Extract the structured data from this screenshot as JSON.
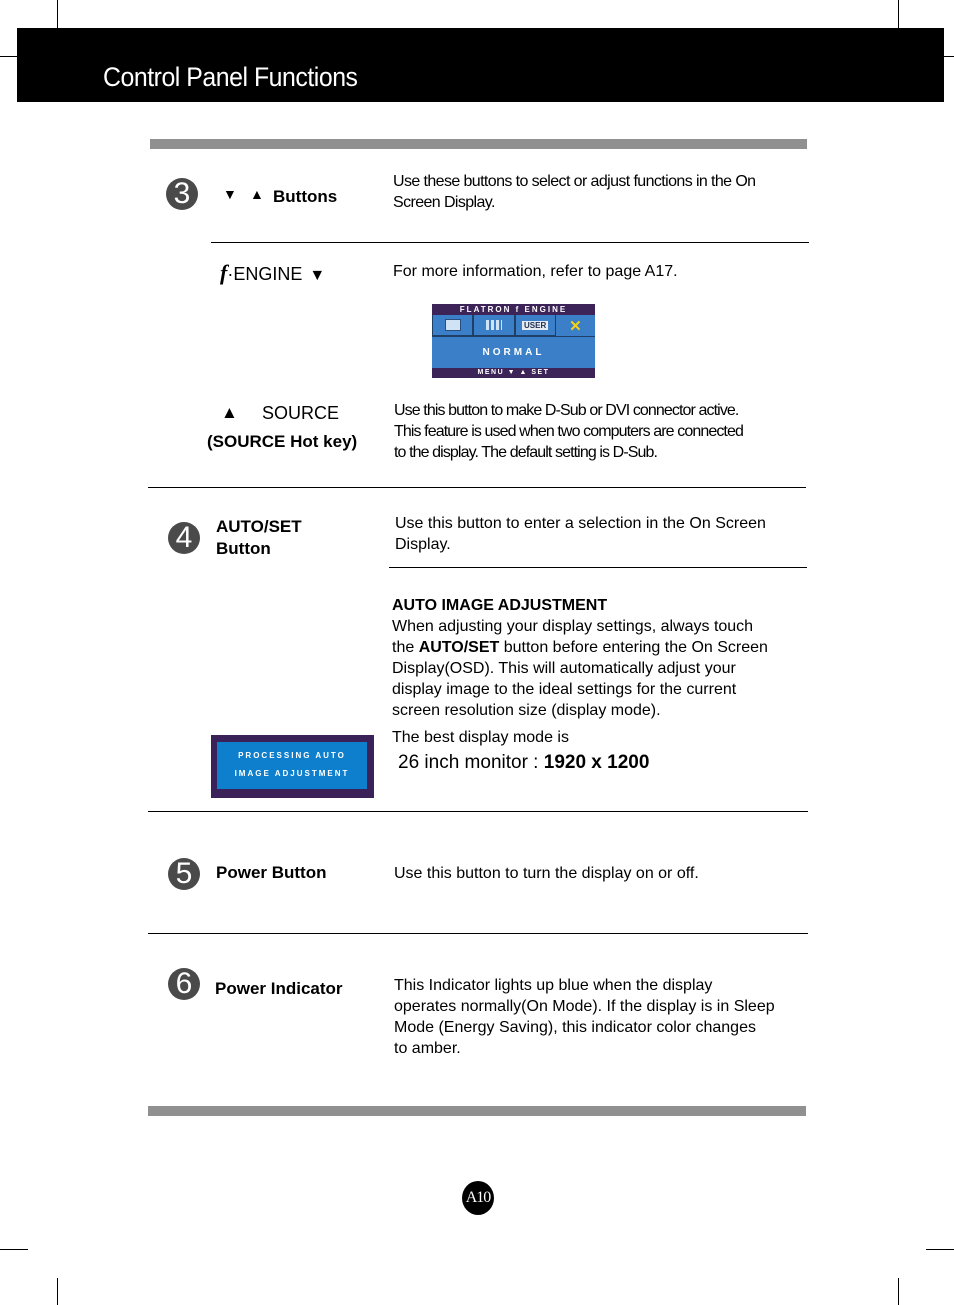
{
  "header": {
    "title": "Control Panel Functions"
  },
  "sections": [
    {
      "number": "3",
      "items": [
        {
          "icons": [
            "down-triangle",
            "up-triangle"
          ],
          "label": "Buttons",
          "description": [
            "Use these buttons to select or adjust functions in the On",
            "Screen Display."
          ]
        },
        {
          "label_prefix": "f",
          "label": "·ENGINE",
          "icon": "down-triangle",
          "description": [
            "For more information, refer to page A17."
          ],
          "osd": {
            "title": "FLATRON  f ENGINE",
            "tabs": [
              "monitor-icon",
              "grid-icon",
              "USER",
              "x-icon"
            ],
            "mode": "NORMAL",
            "footer": "MENU ▼ ▲ SET"
          }
        },
        {
          "icon": "up-triangle",
          "label": "SOURCE",
          "sublabel": "(SOURCE Hot key)",
          "description": [
            "Use this button to make D-Sub or DVI connector active.",
            "This feature is used when two computers are connected",
            "to the display. The default setting is D-Sub."
          ]
        }
      ]
    },
    {
      "number": "4",
      "label_lines": [
        "AUTO/SET",
        "Button"
      ],
      "description": [
        "Use this button to enter a selection in the On Screen",
        "Display."
      ],
      "auto_adjust": {
        "heading": "AUTO IMAGE ADJUSTMENT",
        "line1": "When adjusting your display settings, always touch",
        "line2_pre": "the ",
        "line2_bold": "AUTO/SET",
        "line2_post": " button before entering the On Screen",
        "line3": "Display(OSD). This will automatically adjust your",
        "line4": "display image to the ideal settings for the current",
        "line5": "screen resolution size (display mode).",
        "best_mode_label": "The best display mode is",
        "monitor_label": "26 inch monitor : ",
        "resolution": "1920 x 1200",
        "osd_line1": "PROCESSING AUTO",
        "osd_line2": "IMAGE ADJUSTMENT"
      }
    },
    {
      "number": "5",
      "label": "Power Button",
      "description": [
        "Use this button to turn the display on or off."
      ]
    },
    {
      "number": "6",
      "label": "Power Indicator",
      "description": [
        "This Indicator lights up blue when the display",
        "operates normally(On Mode). If the display is in Sleep",
        "Mode (Energy Saving), this indicator color changes",
        "to amber."
      ]
    }
  ],
  "footer": {
    "page_number": "A10"
  }
}
